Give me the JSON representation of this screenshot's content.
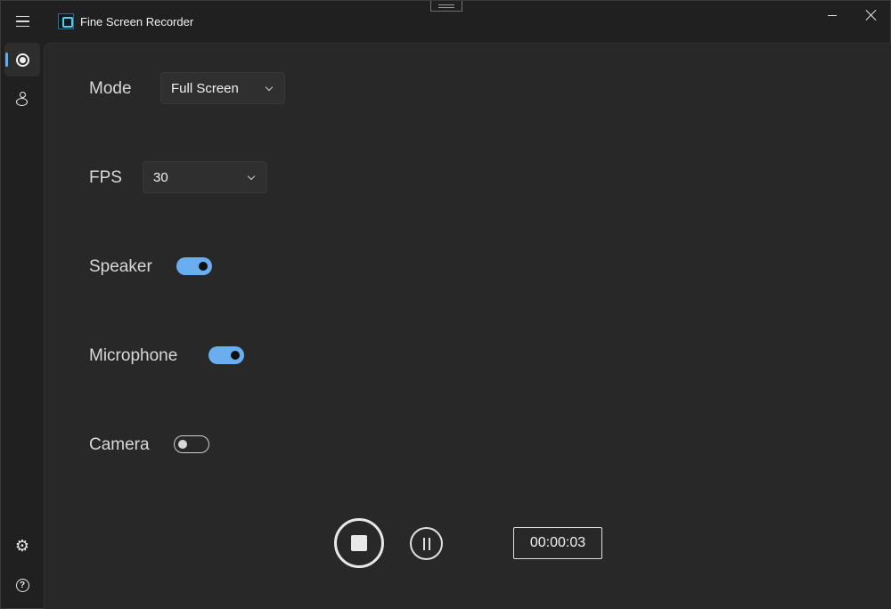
{
  "app": {
    "title": "Fine Screen Recorder",
    "icon": "app-logo-icon"
  },
  "window_controls": {
    "minimize_icon": "minimize-icon",
    "close_icon": "close-icon"
  },
  "sidebar": {
    "items": [
      {
        "id": "record",
        "icon": "record-icon",
        "selected": true
      },
      {
        "id": "webcam",
        "icon": "person-icon",
        "selected": false
      }
    ],
    "footer": [
      {
        "id": "settings",
        "icon": "gear-icon"
      },
      {
        "id": "help",
        "icon": "help-icon"
      }
    ]
  },
  "settings": {
    "mode": {
      "label": "Mode",
      "value": "Full Screen"
    },
    "fps": {
      "label": "FPS",
      "value": "30"
    },
    "speaker": {
      "label": "Speaker",
      "on": true
    },
    "microphone": {
      "label": "Microphone",
      "on": true
    },
    "camera": {
      "label": "Camera",
      "on": false
    }
  },
  "controls": {
    "stop_icon": "stop-icon",
    "pause_icon": "pause-icon",
    "timer": "00:00:03"
  },
  "colors": {
    "accent": "#6aaef0",
    "background": "#282828",
    "sidebar": "#202020"
  }
}
